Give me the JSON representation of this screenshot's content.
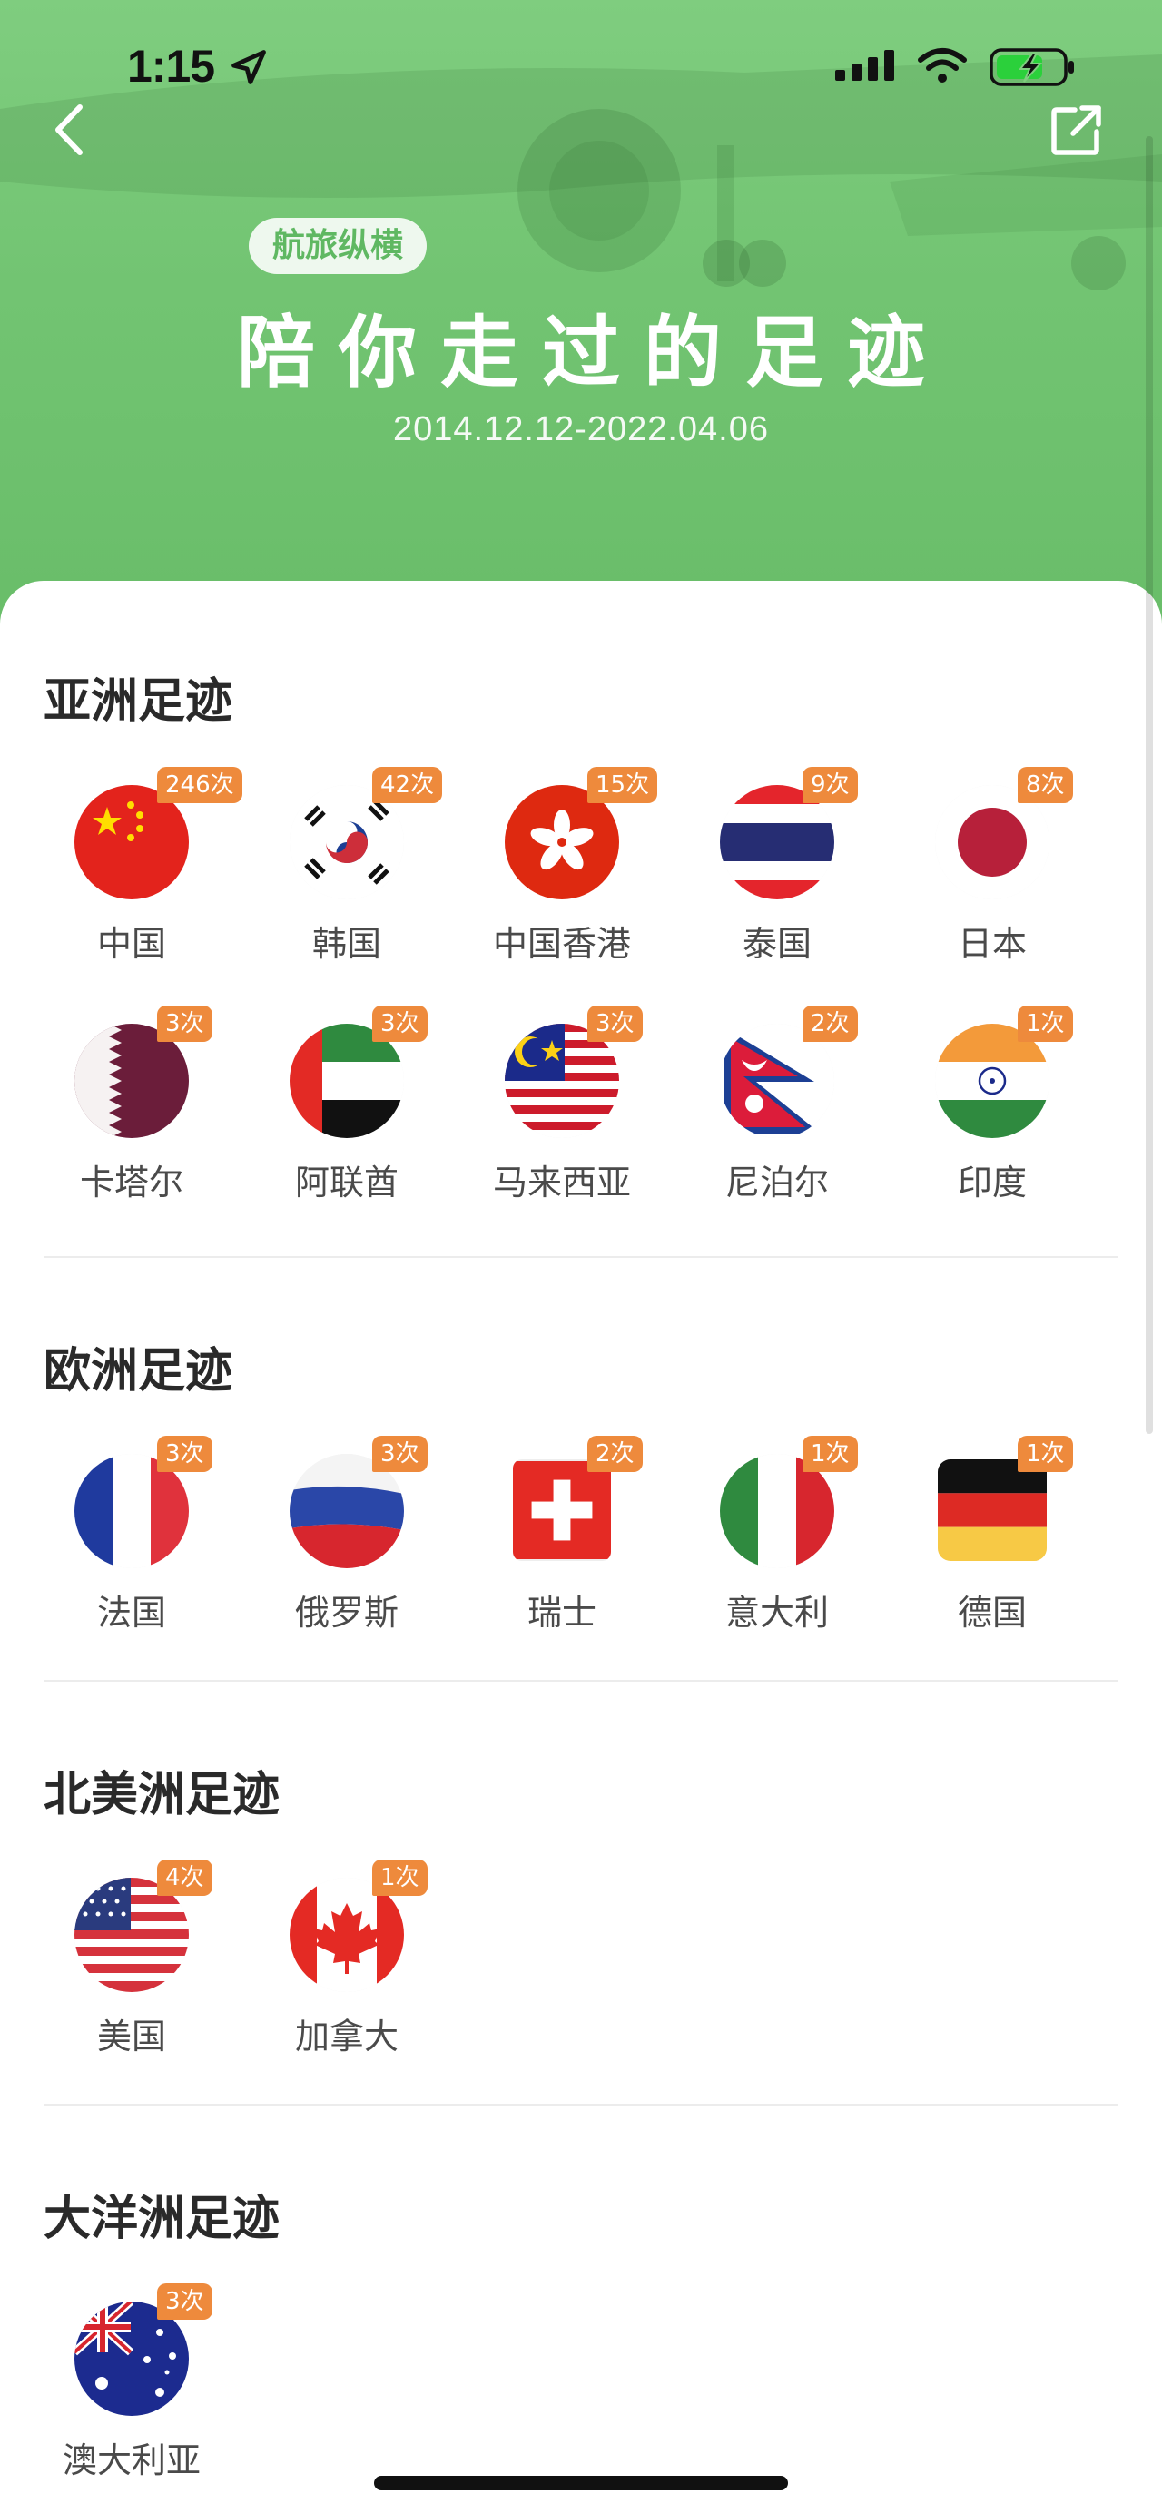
{
  "status_bar": {
    "time": "1:15"
  },
  "header": {
    "tag": "航旅纵横",
    "title": "陪你走过的足迹",
    "date_range": "2014.12.12-2022.04.06"
  },
  "colors": {
    "header_green": "#72c472",
    "badge_orange": "#ee8a3c",
    "tag_text": "#5fb862"
  },
  "sections": [
    {
      "title": "亚洲足迹",
      "countries": [
        {
          "name": "中国",
          "count": "246次",
          "flag": "china-flag-icon"
        },
        {
          "name": "韩国",
          "count": "42次",
          "flag": "korea-flag-icon"
        },
        {
          "name": "中国香港",
          "count": "15次",
          "flag": "hongkong-flag-icon"
        },
        {
          "name": "泰国",
          "count": "9次",
          "flag": "thailand-flag-icon"
        },
        {
          "name": "日本",
          "count": "8次",
          "flag": "japan-flag-icon"
        },
        {
          "name": "卡塔尔",
          "count": "3次",
          "flag": "qatar-flag-icon"
        },
        {
          "name": "阿联酋",
          "count": "3次",
          "flag": "uae-flag-icon"
        },
        {
          "name": "马来西亚",
          "count": "3次",
          "flag": "malaysia-flag-icon"
        },
        {
          "name": "尼泊尔",
          "count": "2次",
          "flag": "nepal-flag-icon"
        },
        {
          "name": "印度",
          "count": "1次",
          "flag": "india-flag-icon"
        }
      ]
    },
    {
      "title": "欧洲足迹",
      "countries": [
        {
          "name": "法国",
          "count": "3次",
          "flag": "france-flag-icon"
        },
        {
          "name": "俄罗斯",
          "count": "3次",
          "flag": "russia-flag-icon"
        },
        {
          "name": "瑞士",
          "count": "2次",
          "flag": "switzerland-flag-icon"
        },
        {
          "name": "意大利",
          "count": "1次",
          "flag": "italy-flag-icon"
        },
        {
          "name": "德国",
          "count": "1次",
          "flag": "germany-flag-icon"
        }
      ]
    },
    {
      "title": "北美洲足迹",
      "countries": [
        {
          "name": "美国",
          "count": "4次",
          "flag": "usa-flag-icon"
        },
        {
          "name": "加拿大",
          "count": "1次",
          "flag": "canada-flag-icon"
        }
      ]
    },
    {
      "title": "大洋洲足迹",
      "countries": [
        {
          "name": "澳大利亚",
          "count": "3次",
          "flag": "australia-flag-icon"
        }
      ]
    }
  ]
}
